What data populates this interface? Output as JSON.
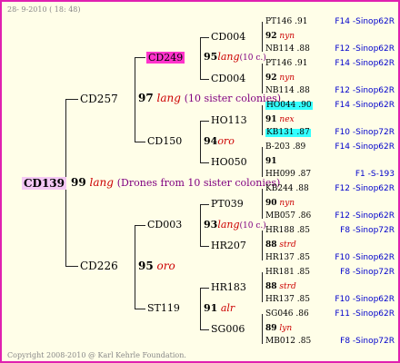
{
  "header_date": "28- 9-2010 ( 18: 48)",
  "footer": "Copyright 2008-2010 @ Karl Kehrle Foundation.",
  "root": {
    "name": "CD139",
    "num": "99",
    "breed": "lang",
    "note": "(Drones from 10 sister colonies)"
  },
  "gen1": [
    {
      "name": "CD257",
      "num": "97",
      "breed": "lang",
      "note": "(10 sister colonies)"
    },
    {
      "name": "CD226",
      "num": "95",
      "breed": "oro"
    }
  ],
  "gen2": [
    {
      "name": "CD249",
      "num": "95",
      "breed": "lang",
      "note": "(10 c.)"
    },
    {
      "name": "CD150",
      "num": "94",
      "breed": "oro"
    },
    {
      "name": "CD003",
      "num": "93",
      "breed": "lang",
      "note": "(10 c.)"
    },
    {
      "name": "ST119",
      "num": "91",
      "breed": "alr"
    }
  ],
  "gen3": [
    {
      "name": "CD004",
      "num": "92",
      "breed": "nyn"
    },
    {
      "name": "CD004",
      "num": "92",
      "breed": "nyn"
    },
    {
      "name": "HO113",
      "num": "91",
      "breed": "nex"
    },
    {
      "name": "HO050",
      "num": "91",
      "breed": ""
    },
    {
      "name": "PT039",
      "num": "90",
      "breed": "nyn"
    },
    {
      "name": "HR207",
      "num": "88",
      "breed": "strd"
    },
    {
      "name": "HR183",
      "num": "88",
      "breed": "strd"
    },
    {
      "name": "SG006",
      "num": "89",
      "breed": "lyn"
    }
  ],
  "gen4": [
    {
      "name": "PT146",
      "val": ".91",
      "src": "F14 -Sinop62R"
    },
    {
      "name": "NB114",
      "val": ".88",
      "src": "F12 -Sinop62R"
    },
    {
      "name": "PT146",
      "val": ".91",
      "src": "F14 -Sinop62R"
    },
    {
      "name": "NB114",
      "val": ".88",
      "src": "F12 -Sinop62R"
    },
    {
      "name": "HO044",
      "val": ".90",
      "src": "F14 -Sinop62R"
    },
    {
      "name": "KB131",
      "val": ".87",
      "src": "F10 -Sinop72R"
    },
    {
      "name": "B-203",
      "val": ".89",
      "src": "F14 -Sinop62R"
    },
    {
      "name": "HH099",
      "val": ".87",
      "src": "F1 -S-193"
    },
    {
      "name": "KB244",
      "val": ".88",
      "src": "F12 -Sinop62R"
    },
    {
      "name": "MB057",
      "val": ".86",
      "src": "F12 -Sinop62R"
    },
    {
      "name": "HR188",
      "val": ".85",
      "src": "F8 -Sinop72R"
    },
    {
      "name": "HR137",
      "val": ".85",
      "src": "F10 -Sinop62R"
    },
    {
      "name": "HR181",
      "val": ".85",
      "src": "F8 -Sinop72R"
    },
    {
      "name": "HR137",
      "val": ".85",
      "src": "F10 -Sinop62R"
    },
    {
      "name": "SG046",
      "val": ".86",
      "src": "F11 -Sinop62R"
    },
    {
      "name": "MB012",
      "val": ".85",
      "src": "F8 -Sinop72R"
    }
  ]
}
